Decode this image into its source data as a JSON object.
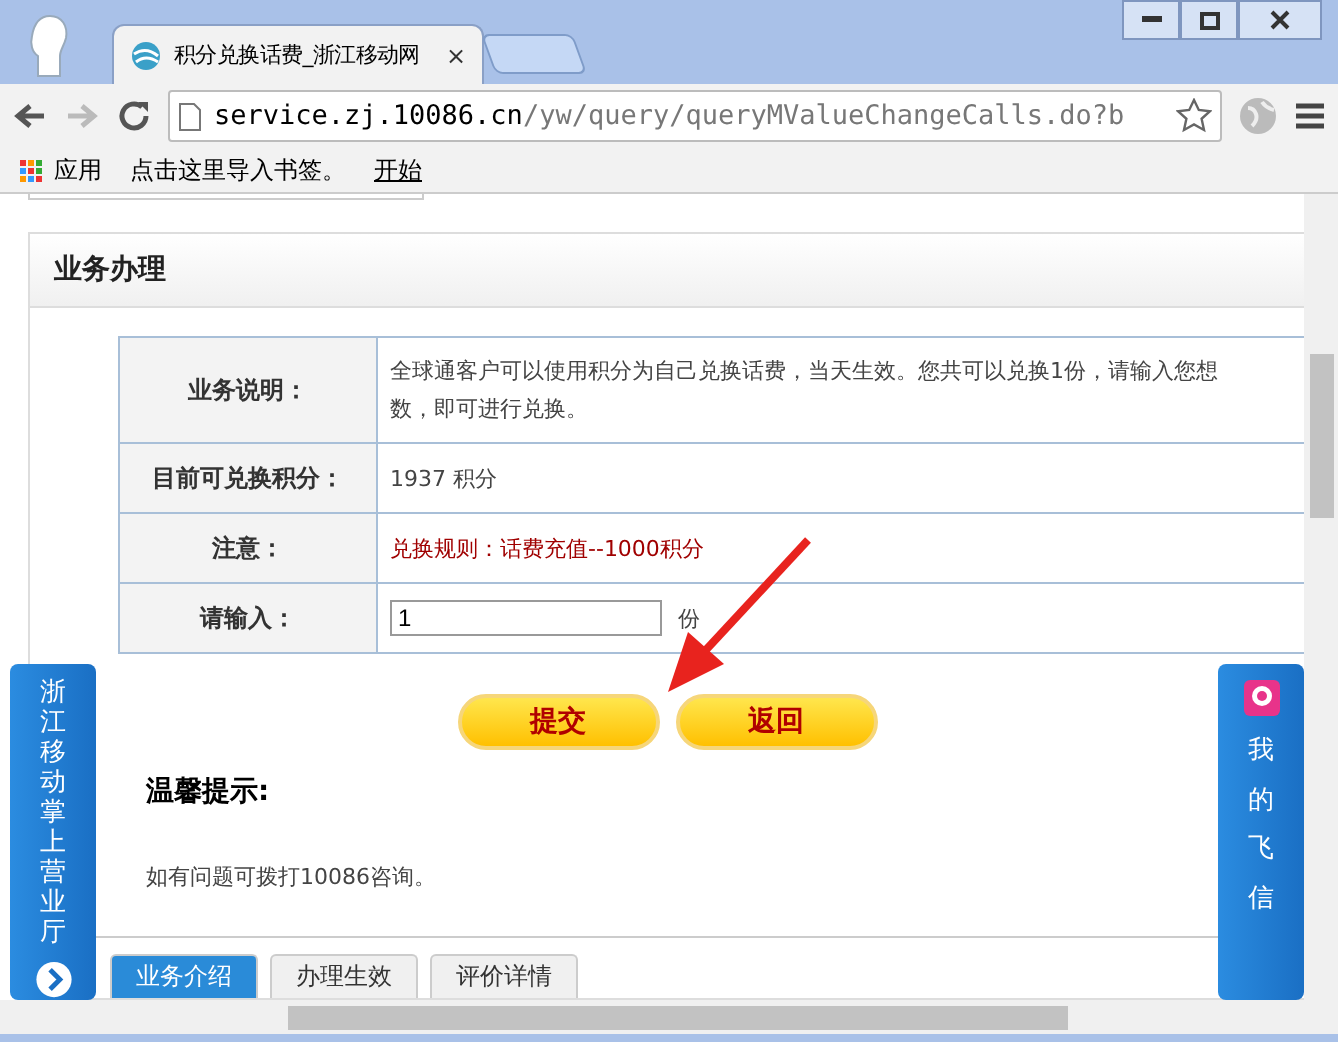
{
  "browser": {
    "tab_title": "积分兑换话费_浙江移动网",
    "tab_close": "×",
    "url_host": "service.zj.10086.cn",
    "url_path": "/yw/query/queryMValueChangeCalls.do?b",
    "bookmarks": [
      {
        "label": "应用",
        "kind": "apps"
      },
      {
        "label": "点击这里导入书签。",
        "kind": "text"
      },
      {
        "label": "开始",
        "kind": "link"
      }
    ]
  },
  "section": {
    "title": "业务办理",
    "rows": [
      {
        "label": "业务说明：",
        "kind": "text",
        "lines": [
          "全球通客户可以使用积分为自己兑换话费，当天生效。您共可以兑换1份，请输入您想",
          "数，即可进行兑换。"
        ]
      },
      {
        "label": "目前可兑换积分：",
        "kind": "text",
        "lines": [
          "1937 积分"
        ]
      },
      {
        "label": "注意：",
        "kind": "warning",
        "lines": [
          "兑换规则：话费充值--1000积分"
        ]
      },
      {
        "label": "请输入：",
        "kind": "input",
        "value": "1",
        "unit": "份"
      }
    ],
    "buttons": [
      "提交",
      "返回"
    ]
  },
  "tips": {
    "title": "温馨提示:",
    "text": "如有问题可拨打10086咨询。"
  },
  "bottom_tabs": [
    {
      "label": "业务介绍",
      "selected": true
    },
    {
      "label": "办理生效",
      "selected": false
    },
    {
      "label": "评价详情",
      "selected": false
    }
  ],
  "left_float": {
    "text": "浙江移动掌上营业厅"
  },
  "right_float": {
    "text": "我的飞信"
  }
}
